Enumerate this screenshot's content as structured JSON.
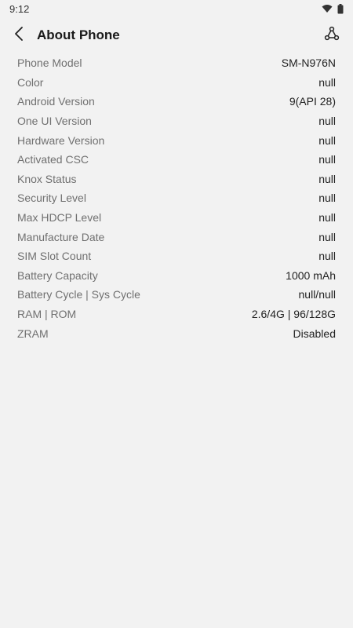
{
  "status_bar": {
    "time": "9:12",
    "icons": [
      "wifi-icon",
      "battery-icon"
    ]
  },
  "app_bar": {
    "title": "About Phone",
    "back_icon": "chevron-left-icon",
    "action_icon": "share-nodes-icon"
  },
  "info": [
    {
      "label": "Phone Model",
      "value": "SM-N976N"
    },
    {
      "label": "Color",
      "value": "null"
    },
    {
      "label": "Android Version",
      "value": "9(API 28)"
    },
    {
      "label": "One UI Version",
      "value": "null"
    },
    {
      "label": "Hardware Version",
      "value": "null"
    },
    {
      "label": "Activated CSC",
      "value": "null"
    },
    {
      "label": "Knox Status",
      "value": "null"
    },
    {
      "label": "Security Level",
      "value": "null"
    },
    {
      "label": "Max HDCP Level",
      "value": "null"
    },
    {
      "label": "Manufacture Date",
      "value": "null"
    },
    {
      "label": "SIM Slot Count",
      "value": "null"
    },
    {
      "label": "Battery Capacity",
      "value": "1000 mAh"
    },
    {
      "label": "Battery Cycle | Sys Cycle",
      "value": "null/null"
    },
    {
      "label": "RAM | ROM",
      "value": "2.6/4G | 96/128G"
    },
    {
      "label": "ZRAM",
      "value": "Disabled"
    }
  ]
}
